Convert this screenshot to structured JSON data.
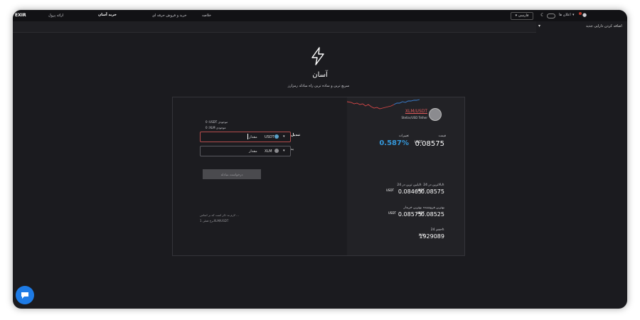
{
  "topbar": {
    "logo": "EXIR",
    "nav": [
      "ارائه پرول",
      "خرید آسان",
      "خرید و فروش حرفه ای",
      "خلاصه"
    ],
    "lang": "فارسی",
    "notifications": "اعلان ها",
    "flag_color": "#c0392b"
  },
  "subbar": {
    "add_asset": "اضافه کردن دارایی جدید"
  },
  "hero": {
    "title": "آسان",
    "subtitle": "سریع ترین و ساده ترین راه مبادله رمزارز"
  },
  "market": {
    "pair": "XLM/USDT",
    "pair_sub": "Stellar/USD Tether",
    "price_label": "قیمت",
    "change_label": "تغییرات",
    "price": "0.08575",
    "price_unit": "USDT",
    "change": "0.587%",
    "change_color": "#3498db",
    "low_label": "پایین ترین در 24h",
    "high_label": "بالاترین در 24h",
    "low": "0.08465",
    "low_unit": "USDT",
    "high": "0.08575",
    "high_unit": "USDT",
    "best_buy_label": "بهترین خریدار",
    "best_sell_label": "بهترین فروشنده",
    "best_buy": "0.08575",
    "best_buy_unit": "USDT",
    "best_sell": "0.08525",
    "best_sell_unit": "USDT",
    "volume_label": "حجم 24h",
    "volume": "1929089",
    "volume_unit": "XLM"
  },
  "trade": {
    "balance1": "0 :USDT موجودی",
    "balance2": "0 :XLM موجودی",
    "convert_label": "تبدیل",
    "to_label": "به",
    "from_currency": "USDT",
    "to_currency": "XLM",
    "amount_placeholder": "مقدار",
    "amount_placeholder2": "مقدار",
    "submit": "درخواست مبادله",
    "note1": "لازم به ذکر است که بر اساس ...",
    "note2": "نرخ فعلی 1XLM/USDT"
  }
}
